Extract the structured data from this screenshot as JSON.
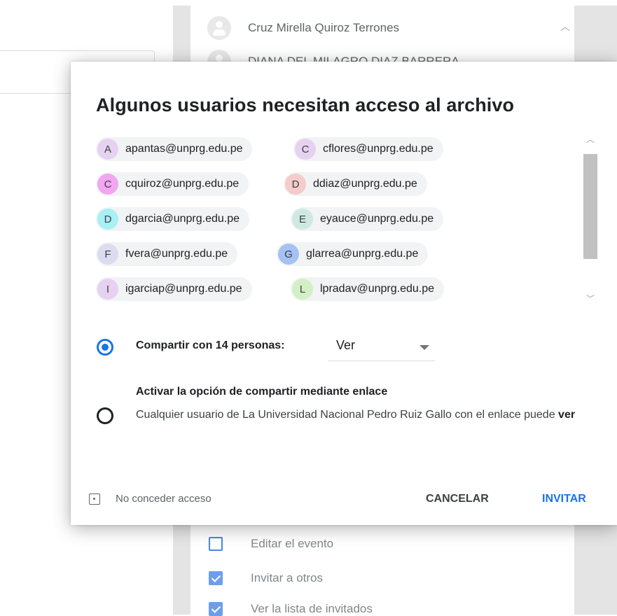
{
  "background": {
    "guests": [
      "Cruz Mirella Quiroz Terrones",
      "DIANA DEL MILAGRO DIAZ BARRERA"
    ],
    "permissions": [
      {
        "label": "Editar el evento",
        "checked": false
      },
      {
        "label": "Invitar a otros",
        "checked": true
      },
      {
        "label": "Ver la lista de invitados",
        "checked": true
      }
    ]
  },
  "dialog": {
    "title": "Algunos usuarios necesitan acceso al archivo",
    "users": [
      {
        "initial": "A",
        "email": "apantas@unprg.edu.pe",
        "color": "#e6d2f0"
      },
      {
        "initial": "C",
        "email": "cflores@unprg.edu.pe",
        "color": "#e6d2f0"
      },
      {
        "initial": "C",
        "email": "cquiroz@unprg.edu.pe",
        "color": "#f1a7f0"
      },
      {
        "initial": "D",
        "email": "ddiaz@unprg.edu.pe",
        "color": "#f4cccc"
      },
      {
        "initial": "D",
        "email": "dgarcia@unprg.edu.pe",
        "color": "#a7f0f4"
      },
      {
        "initial": "E",
        "email": "eyauce@unprg.edu.pe",
        "color": "#cfe9e1"
      },
      {
        "initial": "F",
        "email": "fvera@unprg.edu.pe",
        "color": "#dcdcf0"
      },
      {
        "initial": "G",
        "email": "glarrea@unprg.edu.pe",
        "color": "#a4c2f4"
      },
      {
        "initial": "I",
        "email": "igarciap@unprg.edu.pe",
        "color": "#e6d2f0"
      },
      {
        "initial": "L",
        "email": "lpradav@unprg.edu.pe",
        "color": "#d3efc6"
      }
    ],
    "option_share": {
      "label": "Compartir con 14 personas:",
      "selected": true,
      "role": "Ver"
    },
    "option_link": {
      "label": "Activar la opción de compartir mediante enlace",
      "selected": false,
      "description": "Cualquier usuario de La Universidad Nacional Pedro Ruiz Gallo con el enlace puede",
      "description_bold": "ver"
    },
    "no_access_label": "No conceder acceso",
    "cancel_label": "CANCELAR",
    "invite_label": "INVITAR"
  },
  "colors": {
    "accent": "#1a73e8",
    "chip_bg": "#f1f3f4"
  }
}
